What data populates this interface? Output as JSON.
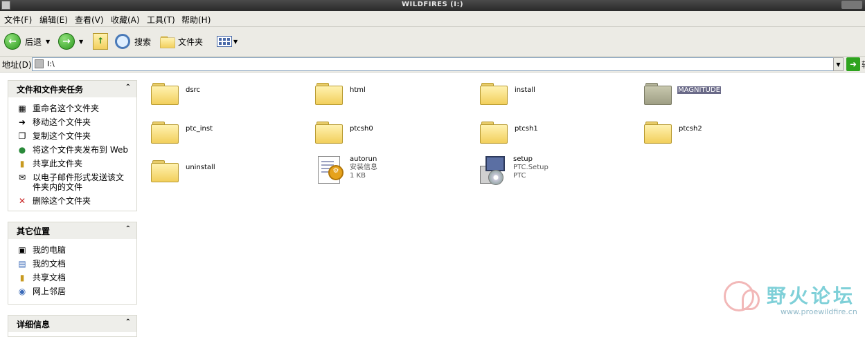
{
  "window": {
    "title": "WILDFIRES (I:)"
  },
  "menu": [
    "文件(F)",
    "编辑(E)",
    "查看(V)",
    "收藏(A)",
    "工具(T)",
    "帮助(H)"
  ],
  "toolbar": {
    "back_label": "后退",
    "search_label": "搜索",
    "folders_label": "文件夹"
  },
  "address": {
    "label": "地址(D)",
    "value": "I:\\",
    "go_label": "转"
  },
  "tasks_panel": {
    "title": "文件和文件夹任务",
    "items": [
      {
        "label": "重命名这个文件夹",
        "icon": "rename-icon"
      },
      {
        "label": "移动这个文件夹",
        "icon": "move-icon"
      },
      {
        "label": "复制这个文件夹",
        "icon": "copy-icon"
      },
      {
        "label": "将这个文件夹发布到 Web",
        "icon": "publish-web-icon"
      },
      {
        "label": "共享此文件夹",
        "icon": "share-icon"
      },
      {
        "label": "以电子邮件形式发送该文件夹内的文件",
        "icon": "email-icon"
      },
      {
        "label": "删除这个文件夹",
        "icon": "delete-icon"
      }
    ]
  },
  "places_panel": {
    "title": "其它位置",
    "items": [
      {
        "label": "我的电脑",
        "icon": "my-computer-icon"
      },
      {
        "label": "我的文档",
        "icon": "my-documents-icon"
      },
      {
        "label": "共享文档",
        "icon": "shared-documents-icon"
      },
      {
        "label": "网上邻居",
        "icon": "network-icon"
      }
    ]
  },
  "details_panel": {
    "title": "详细信息"
  },
  "files": [
    {
      "name": "dsrc",
      "type": "folder"
    },
    {
      "name": "html",
      "type": "folder"
    },
    {
      "name": "install",
      "type": "folder"
    },
    {
      "name": "MAGNITUDE",
      "type": "folder",
      "selected": true
    },
    {
      "name": "ptc_inst",
      "type": "folder"
    },
    {
      "name": "ptcsh0",
      "type": "folder"
    },
    {
      "name": "ptcsh1",
      "type": "folder"
    },
    {
      "name": "ptcsh2",
      "type": "folder"
    },
    {
      "name": "uninstall",
      "type": "folder"
    },
    {
      "name": "autorun",
      "type": "inf",
      "desc": "安装信息",
      "size": "1 KB"
    },
    {
      "name": "setup",
      "type": "exe",
      "desc": "PTC.Setup",
      "company": "PTC"
    }
  ],
  "watermark": {
    "brand": "野火论坛",
    "url": "www.proewildfire.cn"
  }
}
